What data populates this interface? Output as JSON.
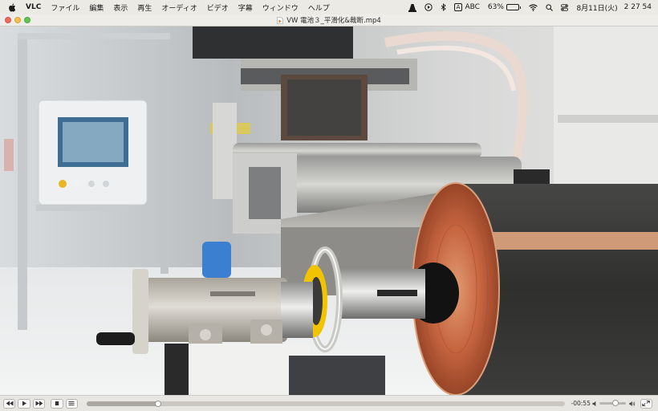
{
  "menubar": {
    "apple_icon": "apple-logo-icon",
    "app_name": "VLC",
    "items": [
      "ファイル",
      "編集",
      "表示",
      "再生",
      "オーディオ",
      "ビデオ",
      "字幕",
      "ウィンドウ",
      "ヘルプ"
    ],
    "status": {
      "input_source": "ABC",
      "battery_percent": "63%",
      "battery_level": 0.63,
      "battery_color": "#e7c12a",
      "date": "8月11日(火)",
      "time": "2 27 54"
    }
  },
  "window": {
    "title": "VW 電池３_平滑化&裁断.mp4"
  },
  "player": {
    "position_fraction": 0.15,
    "remaining_time": "-00:55",
    "volume_fraction": 0.62,
    "buttons": [
      "rewind-icon",
      "play-icon",
      "fast-forward-icon",
      "stop-icon",
      "playlist-icon"
    ]
  },
  "colors": {
    "accent_copper": "#c4633e",
    "traffic_close": "#ed6a5e",
    "traffic_minimize": "#f5bf4f",
    "traffic_zoom": "#61c554"
  }
}
